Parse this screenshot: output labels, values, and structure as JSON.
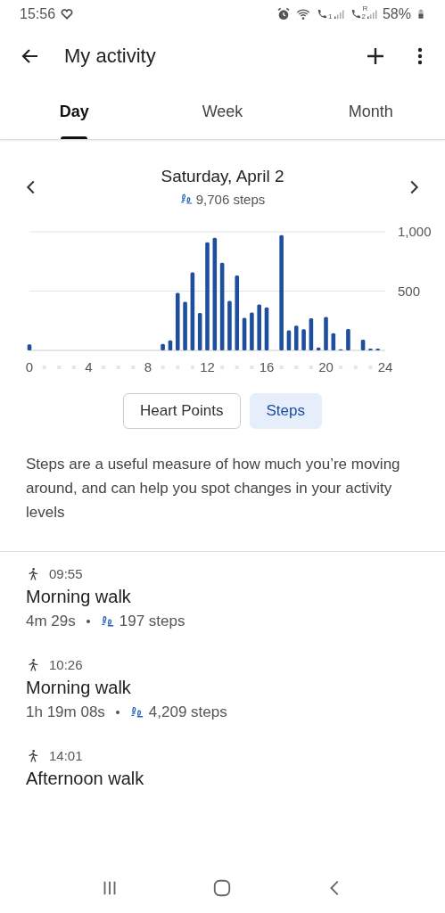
{
  "status_bar": {
    "time": "15:56",
    "sim1": "1",
    "sim2": "2",
    "roaming": "R",
    "battery": "58%"
  },
  "app_bar": {
    "title": "My activity"
  },
  "tabs": [
    {
      "label": "Day",
      "selected": true
    },
    {
      "label": "Week",
      "selected": false
    },
    {
      "label": "Month",
      "selected": false
    }
  ],
  "summary": {
    "date": "Saturday, April 2",
    "steps": "9,706 steps"
  },
  "chart": {
    "chart_data": {
      "type": "bar",
      "x": [
        0,
        9,
        9.5,
        10,
        10.5,
        11,
        11.5,
        12,
        12.5,
        13,
        13.5,
        14,
        14.5,
        15,
        15.5,
        16,
        17,
        17.5,
        18,
        18.5,
        19,
        19.5,
        20,
        20.5,
        21,
        21.5,
        22.5,
        23,
        23.5
      ],
      "series": [
        {
          "color": "#1f4e9e",
          "values": [
            50,
            55,
            85,
            485,
            410,
            657,
            315,
            912,
            950,
            738,
            418,
            632,
            275,
            320,
            388,
            363,
            972,
            169,
            209,
            179,
            270,
            25,
            282,
            144,
            10,
            181,
            91,
            15,
            15
          ]
        }
      ],
      "xlim": [
        0,
        24
      ],
      "ylim": [
        0,
        1000
      ],
      "xticks": [
        0,
        4,
        8,
        12,
        16,
        20,
        24
      ],
      "yticks": [
        {
          "value": 500,
          "label": "500"
        },
        {
          "value": 1000,
          "label": "1,000"
        }
      ]
    }
  },
  "metric_toggle": [
    {
      "label": "Heart Points",
      "selected": false
    },
    {
      "label": "Steps",
      "selected": true
    }
  ],
  "description": "Steps are a useful measure of how much you’re moving around, and can help you spot changes in your activity levels",
  "activities": [
    {
      "time": "09:55",
      "title": "Morning walk",
      "duration": "4m 29s",
      "steps": "197 steps"
    },
    {
      "time": "10:26",
      "title": "Morning walk",
      "duration": "1h 19m 08s",
      "steps": "4,209 steps"
    },
    {
      "time": "14:01",
      "title": "Afternoon walk"
    }
  ]
}
